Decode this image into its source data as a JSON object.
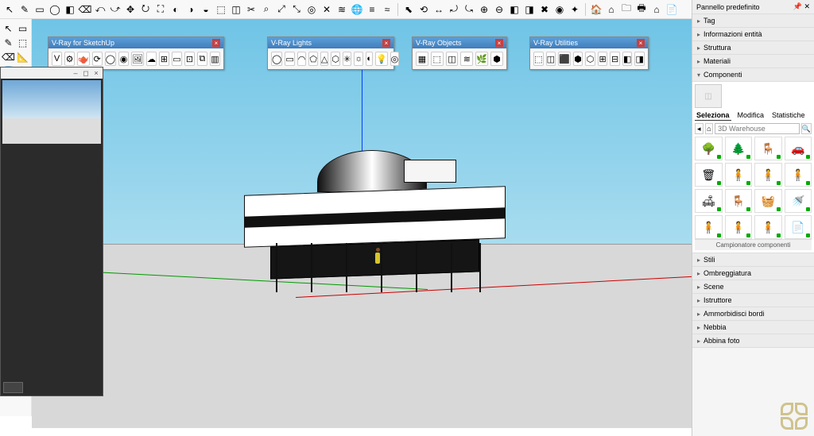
{
  "tray": {
    "title": "Pannello predefinito",
    "accordion_top": [
      "Tag",
      "Informazioni entità",
      "Struttura",
      "Materiali"
    ],
    "components_label": "Componenti",
    "tabs": {
      "select": "Seleziona",
      "edit": "Modifica",
      "stats": "Statistiche"
    },
    "search_placeholder": "3D Warehouse",
    "grid_footer": "Campionatore componenti",
    "accordion_bottom": [
      "Stili",
      "Ombreggiatura",
      "Scene",
      "Istruttore",
      "Ammorbidisci bordi",
      "Nebbia",
      "Abbina foto"
    ]
  },
  "vray": {
    "sketchup": {
      "title": "V-Ray for SketchUp"
    },
    "lights": {
      "title": "V-Ray Lights"
    },
    "objects": {
      "title": "V-Ray Objects"
    },
    "utilities": {
      "title": "V-Ray Utilities"
    }
  },
  "icons": {
    "main_toolbar": [
      "↖",
      "✎",
      "▭",
      "◯",
      "◧",
      "⌫",
      "⤺",
      "⤻",
      "✥",
      "⭮",
      "⛶",
      "◐",
      "◑",
      "◒",
      "⬚",
      "◫",
      "✂",
      "⌕",
      "⤢",
      "⤡",
      "◎",
      "✕",
      "≋",
      "🌐",
      "≡",
      "≈",
      "│",
      "⬉",
      "⟲",
      "↔",
      "⤾",
      "⤿",
      "⊕",
      "⊖",
      "◧",
      "◨",
      "✖",
      "◉",
      "✦",
      "│",
      "🏠",
      "⌂",
      "🗀",
      "🖶",
      "⌂",
      "📄"
    ],
    "left": [
      [
        "↖",
        "▭"
      ],
      [
        "✎",
        "⬚"
      ],
      [
        "⌫",
        "📐"
      ],
      [
        "🪣",
        "🎨"
      ]
    ],
    "vray_sketchup": [
      "V",
      "⚙",
      "🫖",
      "⟳",
      "◯",
      "◉",
      "🖼",
      "☁",
      "⊞",
      "▭",
      "⊡",
      "⧉",
      "▥"
    ],
    "vray_lights": [
      "◯",
      "▭",
      "◠",
      "⬠",
      "△",
      "⬡",
      "✳",
      "☼",
      "◐",
      "💡",
      "◎"
    ],
    "vray_objects": [
      "▦",
      "⬚",
      "◫",
      "≋",
      "🌿",
      "⬢"
    ],
    "vray_utilities": [
      "⬚",
      "◫",
      "⬛",
      "⬢",
      "⬡",
      "⊞",
      "⊟",
      "◧",
      "◨"
    ],
    "components": [
      "🌳",
      "🌲",
      "🪑",
      "🚗",
      "🗑",
      "🧍",
      "🧍",
      "🧍",
      "🛋",
      "🪑",
      "🧺",
      "🚿",
      "🧍",
      "🧍",
      "🧍",
      "📄"
    ]
  }
}
